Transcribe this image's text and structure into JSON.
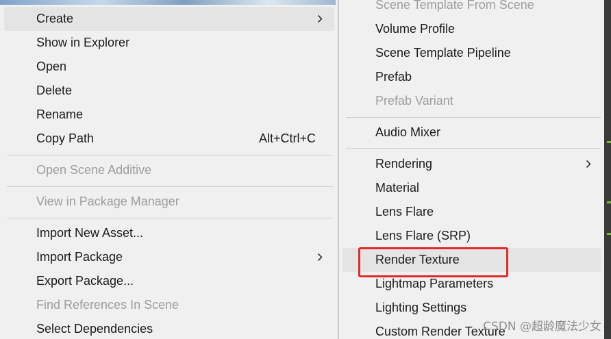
{
  "left_menu": {
    "items": [
      {
        "label": "Create",
        "has_submenu": true,
        "state": "hovered"
      },
      {
        "label": "Show in Explorer"
      },
      {
        "label": "Open"
      },
      {
        "label": "Delete"
      },
      {
        "label": "Rename"
      },
      {
        "label": "Copy Path",
        "shortcut": "Alt+Ctrl+C"
      },
      {
        "label": "Open Scene Additive",
        "state": "disabled"
      },
      {
        "label": "View in Package Manager",
        "state": "disabled"
      },
      {
        "label": "Import New Asset..."
      },
      {
        "label": "Import Package",
        "has_submenu": true
      },
      {
        "label": "Export Package..."
      },
      {
        "label": "Find References In Scene",
        "state": "disabled"
      },
      {
        "label": "Select Dependencies"
      }
    ]
  },
  "right_menu": {
    "items": [
      {
        "label": "Scene Template From Scene",
        "state": "disabled"
      },
      {
        "label": "Volume Profile"
      },
      {
        "label": "Scene Template Pipeline"
      },
      {
        "label": "Prefab"
      },
      {
        "label": "Prefab Variant",
        "state": "disabled"
      },
      {
        "label": "Audio Mixer"
      },
      {
        "label": "Rendering",
        "has_submenu": true
      },
      {
        "label": "Material"
      },
      {
        "label": "Lens Flare"
      },
      {
        "label": "Lens Flare (SRP)"
      },
      {
        "label": "Render Texture",
        "state": "hovered",
        "annotated": true
      },
      {
        "label": "Lightmap Parameters"
      },
      {
        "label": "Lighting Settings"
      },
      {
        "label": "Custom Render Texture"
      }
    ]
  },
  "annotation": {
    "color": "#e02a2a"
  },
  "watermark": "CSDN @超龄魔法少女",
  "icons": {
    "submenu_arrow": "chevron-right-icon"
  }
}
